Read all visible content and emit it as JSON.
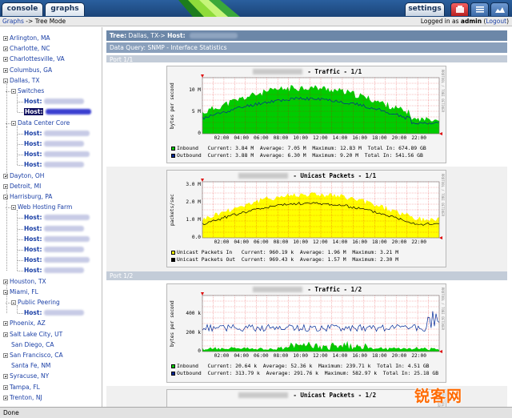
{
  "tabs": {
    "console": "console",
    "graphs": "graphs",
    "settings": "settings"
  },
  "breadcrumb": {
    "root": "Graphs",
    "sep": " -> ",
    "current": "Tree Mode"
  },
  "login": {
    "prefix": "Logged in as ",
    "user": "admin",
    "logout": "Logout"
  },
  "tree": [
    {
      "label": "Arlington, MA",
      "type": "site",
      "expanded": false
    },
    {
      "label": "Charlotte, NC",
      "type": "site",
      "expanded": false
    },
    {
      "label": "Charlottesville, VA",
      "type": "site",
      "expanded": false
    },
    {
      "label": "Columbus, GA",
      "type": "site",
      "expanded": false
    },
    {
      "label": "Dallas, TX",
      "type": "site",
      "expanded": true
    },
    {
      "label": "Switches",
      "type": "group",
      "expanded": true
    },
    {
      "label": "Host:",
      "type": "host"
    },
    {
      "label": "Host:",
      "type": "host",
      "selected": true
    },
    {
      "label": "Data Center Core",
      "type": "group",
      "expanded": true
    },
    {
      "label": "Host:",
      "type": "host"
    },
    {
      "label": "Host:",
      "type": "host"
    },
    {
      "label": "Host:",
      "type": "host"
    },
    {
      "label": "Host:",
      "type": "host"
    },
    {
      "label": "Dayton, OH",
      "type": "site",
      "expanded": false
    },
    {
      "label": "Detroit, MI",
      "type": "site",
      "expanded": false
    },
    {
      "label": "Harrisburg, PA",
      "type": "site",
      "expanded": true
    },
    {
      "label": "Web Hosting Farm",
      "type": "group",
      "expanded": true
    },
    {
      "label": "Host:",
      "type": "host"
    },
    {
      "label": "Host:",
      "type": "host"
    },
    {
      "label": "Host:",
      "type": "host"
    },
    {
      "label": "Host:",
      "type": "host"
    },
    {
      "label": "Host:",
      "type": "host"
    },
    {
      "label": "Host:",
      "type": "host"
    },
    {
      "label": "Houston, TX",
      "type": "site",
      "expanded": false
    },
    {
      "label": "Miami, FL",
      "type": "site",
      "expanded": true
    },
    {
      "label": "Public Peering",
      "type": "group",
      "expanded": true
    },
    {
      "label": "Host:",
      "type": "host"
    },
    {
      "label": "Phoenix, AZ",
      "type": "site",
      "expanded": false
    },
    {
      "label": "Salt Lake City, UT",
      "type": "site",
      "expanded": false
    },
    {
      "label": "San Diego, CA",
      "type": "leaf"
    },
    {
      "label": "San Francisco, CA",
      "type": "site",
      "expanded": false
    },
    {
      "label": "Santa Fe, NM",
      "type": "leaf"
    },
    {
      "label": "Syracuse, NY",
      "type": "site",
      "expanded": false
    },
    {
      "label": "Tampa, FL",
      "type": "site",
      "expanded": false
    },
    {
      "label": "Trenton, NJ",
      "type": "site",
      "expanded": false
    }
  ],
  "main": {
    "tree_header": {
      "tree_label": "Tree:",
      "tree_value": " Dallas, TX-> ",
      "host_label": "Host:"
    },
    "data_query": "Data Query: SNMP - Interface Statistics",
    "ports": [
      "Port 1/1",
      "Port 1/2"
    ]
  },
  "colors": {
    "inbound": "#00cc00",
    "outbound": "#002a97",
    "unicast_in": "#ffff00",
    "unicast_out": "#000000",
    "grid": "#e00000"
  },
  "x_ticks": [
    "02:00",
    "04:00",
    "06:00",
    "08:00",
    "10:00",
    "12:00",
    "14:00",
    "16:00",
    "18:00",
    "20:00",
    "22:00"
  ],
  "rrd_credit": "RRDTOOL / TOBI OETIKER",
  "graphs": [
    {
      "title": " - Traffic - 1/1",
      "ylabel": "bytes per second",
      "yticks": [
        "10 M",
        "5 M",
        "0"
      ],
      "ymax": 13,
      "style": "traffic",
      "legend": [
        {
          "name": "Inbound ",
          "current": "3.84 M",
          "average": "7.05 M",
          "maximum": "12.83 M",
          "total": "674.89 GB",
          "color": "#00cc00"
        },
        {
          "name": "Outbound",
          "current": "3.88 M",
          "average": "6.30 M",
          "maximum": "9.20 M",
          "total": "541.56 GB",
          "color": "#002a97"
        }
      ]
    },
    {
      "title": " - Unicast Packets - 1/1",
      "ylabel": "packets/sec",
      "yticks": [
        "3.0 M",
        "2.0 M",
        "1.0 M",
        "0.0"
      ],
      "ymax": 3.2,
      "style": "unicast",
      "legend": [
        {
          "name": "Unicast Packets In ",
          "current": "960.19 k",
          "average": "1.96 M",
          "maximum": "3.21 M",
          "color": "#ffff00"
        },
        {
          "name": "Unicast Packets Out",
          "current": "969.43 k",
          "average": "1.57 M",
          "maximum": "2.30 M",
          "color": "#000000"
        }
      ]
    },
    {
      "title": " - Traffic - 1/2",
      "ylabel": "bytes per second",
      "yticks": [
        "400 k",
        "200 k",
        "0"
      ],
      "ymax": 600,
      "style": "traffic2",
      "legend": [
        {
          "name": "Inbound ",
          "current": "20.64 k",
          "average": "52.36 k",
          "maximum": "239.71 k",
          "total": "4.51 GB",
          "color": "#00cc00"
        },
        {
          "name": "Outbound",
          "current": "313.79 k",
          "average": "291.76 k",
          "maximum": "582.97 k",
          "total": "25.18 GB",
          "color": "#002a97"
        }
      ]
    },
    {
      "title": " - Unicast Packets - 1/2",
      "ylabel": "",
      "yticks": [],
      "style": "partial",
      "legend": []
    }
  ],
  "status": "Done",
  "watermark": "锐客网"
}
